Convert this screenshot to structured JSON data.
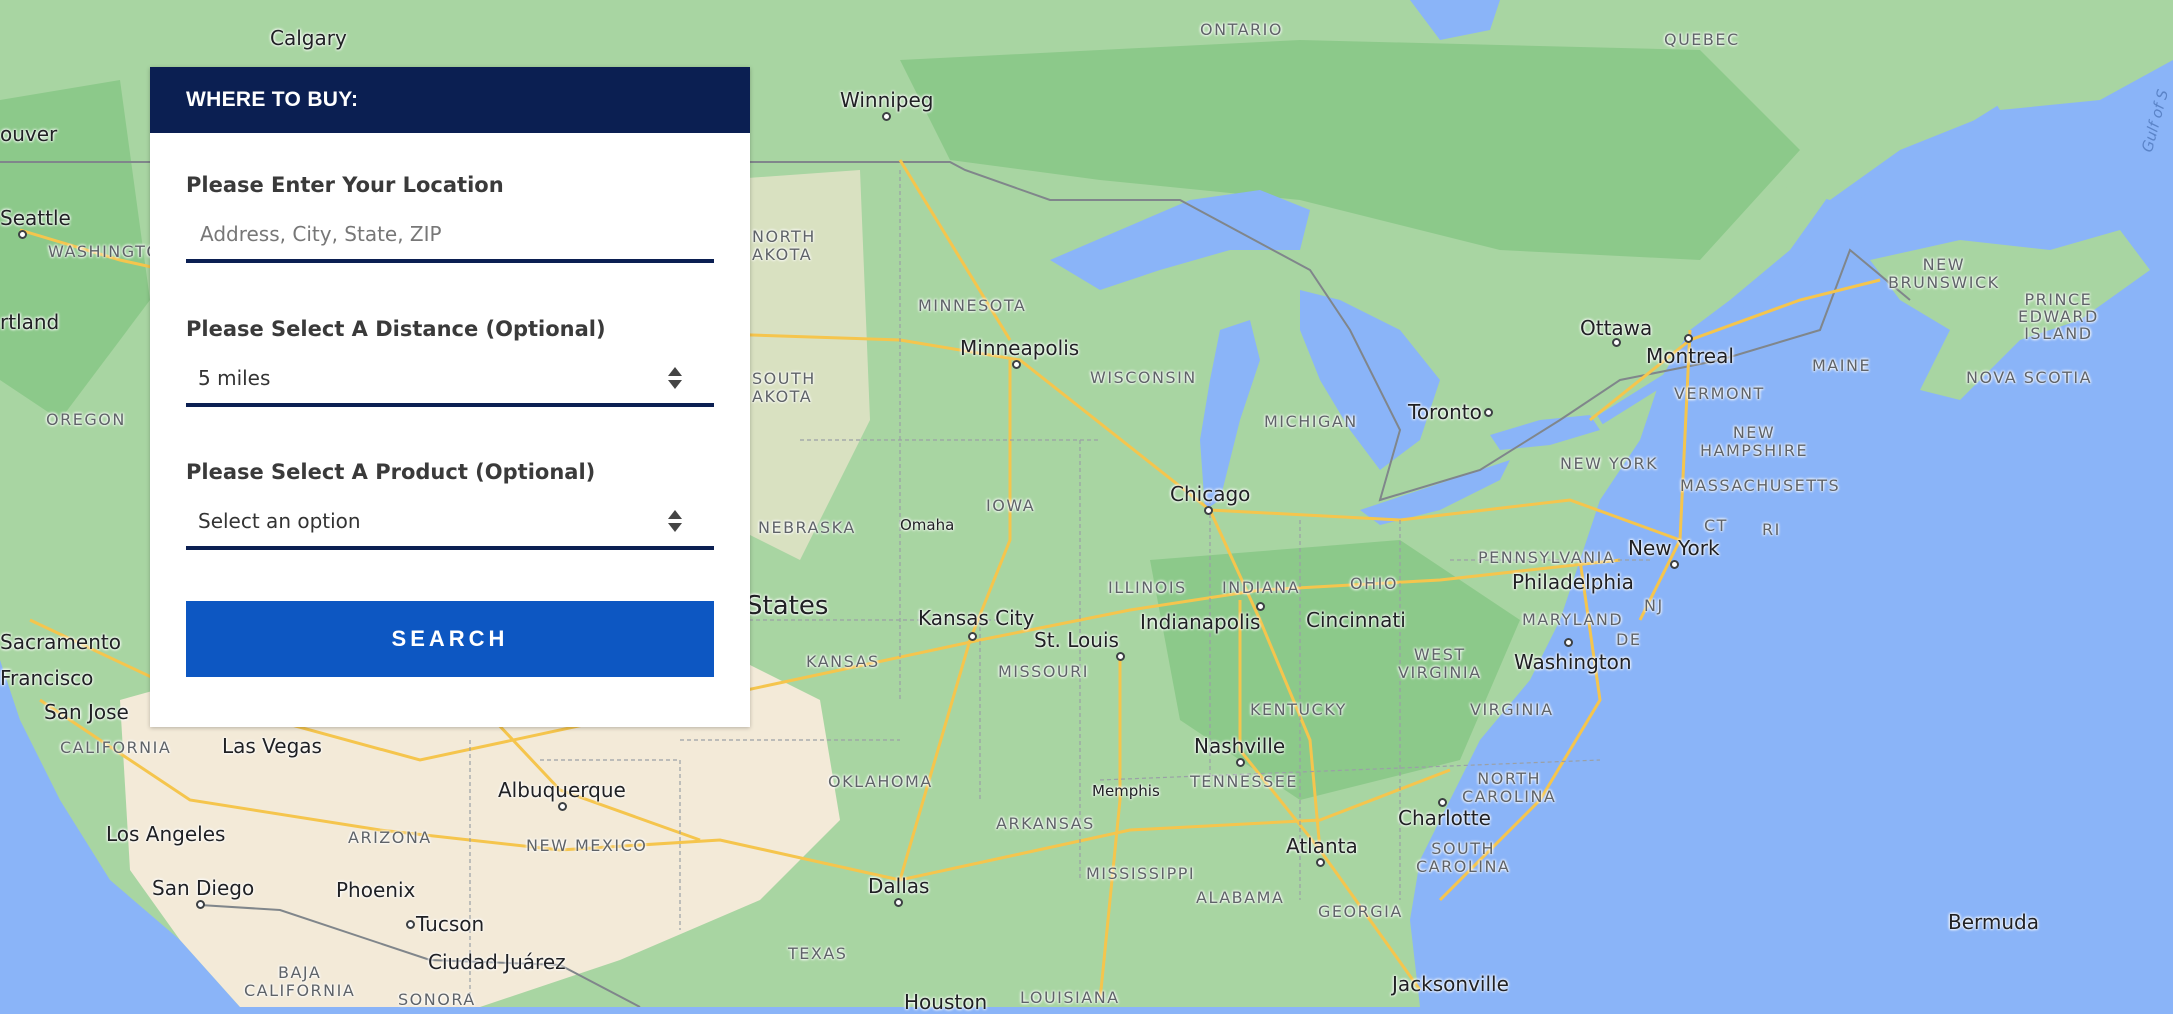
{
  "panel": {
    "title": "WHERE TO BUY:",
    "location": {
      "label": "Please Enter Your Location",
      "placeholder": "Address, City, State, ZIP",
      "value": ""
    },
    "distance": {
      "label": "Please Select A Distance (Optional)",
      "selected": "5 miles"
    },
    "product": {
      "label": "Please Select A Product (Optional)",
      "selected": "Select an option"
    },
    "search_label": "SEARCH"
  },
  "map": {
    "colors": {
      "water": "#8ab4f8",
      "land_green": "#a8d5a2",
      "land_dark_green": "#8cc98a",
      "desert": "#f3ead8",
      "highway": "#f5c54d",
      "border": "#9aa0a6"
    },
    "labels": {
      "calgary": "Calgary",
      "vancouver": "ouver",
      "seattle": "Seattle",
      "washington_state": "WASHINGTO",
      "portland": "rtland",
      "oregon": "OREGON",
      "sacramento": "Sacramento",
      "san_francisco": "Francisco",
      "san_jose": "San Jose",
      "california": "CALIFORNIA",
      "las_vegas": "Las Vegas",
      "los_angeles": "Los Angeles",
      "san_diego": "San Diego",
      "baja_california": "BAJA\nCALIFORNIA",
      "sonora": "SONORA",
      "tucson": "Tucson",
      "phoenix": "Phoenix",
      "arizona": "ARIZONA",
      "albuquerque": "Albuquerque",
      "new_mexico": "NEW MEXICO",
      "ciudad_juarez": "Ciudad Juárez",
      "texas": "TEXAS",
      "houston": "Houston",
      "dallas": "Dallas",
      "oklahoma": "OKLAHOMA",
      "kansas": "KANSAS",
      "kansas_city": "Kansas City",
      "nebraska": "NEBRASKA",
      "omaha": "Omaha",
      "united_states": "States",
      "south_dakota": "SOUTH\nAKOTA",
      "north_dakota": "NORTH\nAKOTA",
      "winnipeg": "Winnipeg",
      "minnesota": "MINNESOTA",
      "minneapolis": "Minneapolis",
      "wisconsin": "WISCONSIN",
      "iowa": "IOWA",
      "missouri": "MISSOURI",
      "st_louis": "St. Louis",
      "illinois": "ILLINOIS",
      "chicago": "Chicago",
      "indiana": "INDIANA",
      "indianapolis": "Indianapolis",
      "michigan": "MICHIGAN",
      "ohio": "OHIO",
      "cincinnati": "Cincinnati",
      "kentucky": "KENTUCKY",
      "tennessee": "TENNESSEE",
      "nashville": "Nashville",
      "memphis": "Memphis",
      "arkansas": "ARKANSAS",
      "mississippi": "MISSISSIPPI",
      "alabama": "ALABAMA",
      "louisiana": "LOUISIANA",
      "georgia": "GEORGIA",
      "atlanta": "Atlanta",
      "jacksonville": "Jacksonville",
      "south_carolina": "SOUTH\nCAROLINA",
      "north_carolina": "NORTH\nCAROLINA",
      "charlotte": "Charlotte",
      "virginia": "VIRGINIA",
      "west_virginia": "WEST\nVIRGINIA",
      "washington_dc": "Washington",
      "maryland": "MARYLAND",
      "de": "DE",
      "nj": "NJ",
      "philadelphia": "Philadelphia",
      "pennsylvania": "PENNSYLVANIA",
      "new_york_state": "NEW YORK",
      "new_york": "New York",
      "ct": "CT",
      "ri": "RI",
      "massachusetts": "MASSACHUSETTS",
      "new_hampshire": "NEW\nHAMPSHIRE",
      "vermont": "VERMONT",
      "maine": "MAINE",
      "toronto": "Toronto",
      "ottawa": "Ottawa",
      "montreal": "Montreal",
      "quebec": "QUEBEC",
      "ontario": "ONTARIO",
      "new_brunswick": "NEW\nBRUNSWICK",
      "pei": "PRINCE\nEDWARD\nISLAND",
      "nova_scotia": "NOVA SCOTIA",
      "gulf": "Gulf of S",
      "bermuda": "Bermuda"
    }
  }
}
